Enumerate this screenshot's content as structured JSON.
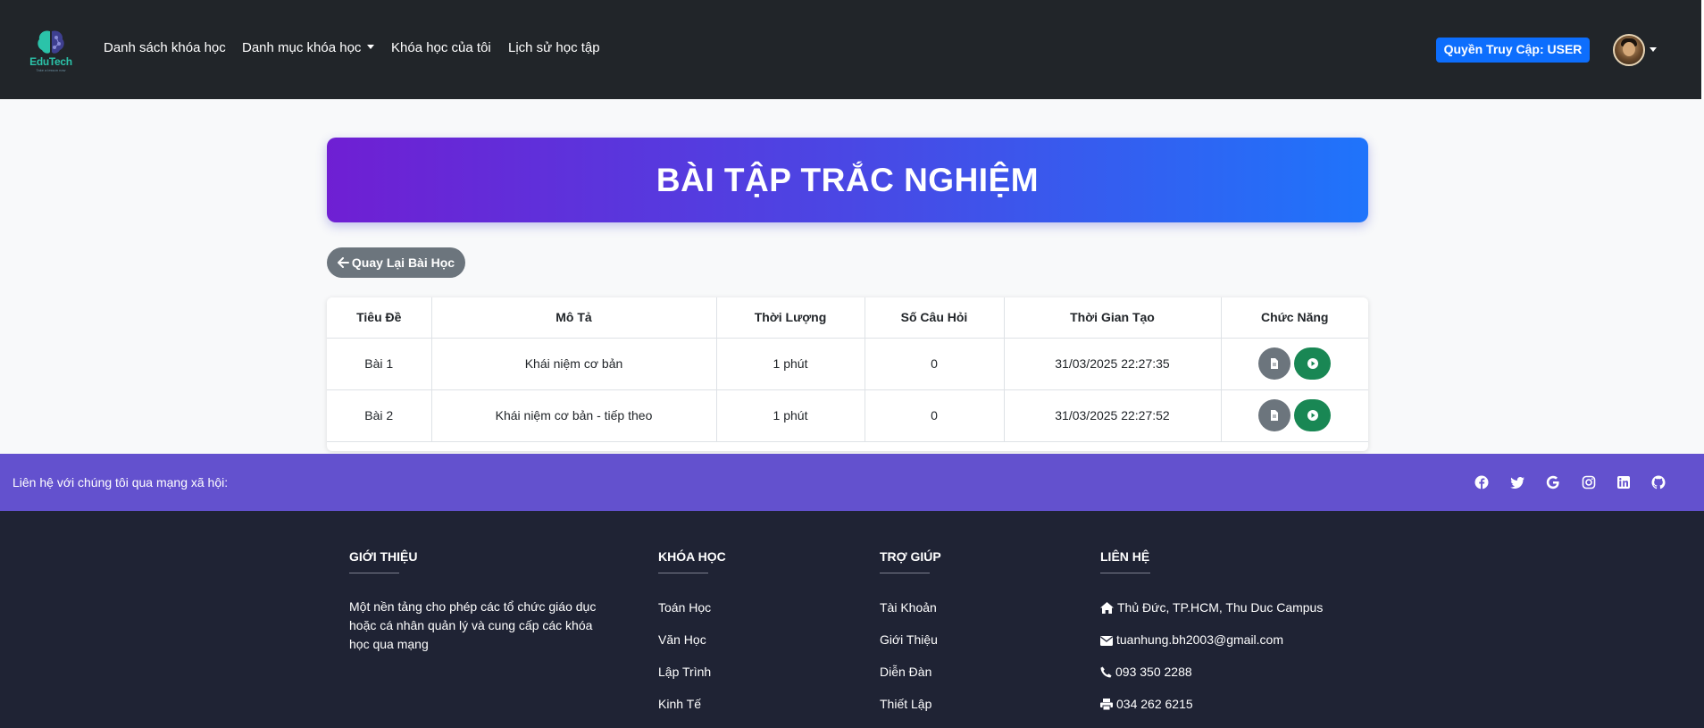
{
  "navbar": {
    "brand": "EduTech",
    "brand_tagline": "Take a lesson now",
    "links": {
      "course_list": "Danh sách khóa học",
      "categories": "Danh mục khóa học",
      "my_courses": "Khóa học của tôi",
      "history": "Lịch sử học tập"
    },
    "role_badge": "Quyền Truy Cập: USER"
  },
  "page": {
    "title": "BÀI TẬP TRẮC NGHIỆM",
    "back_button": "Quay Lại Bài Học"
  },
  "table": {
    "headers": [
      "Tiêu Đề",
      "Mô Tả",
      "Thời Lượng",
      "Số Câu Hỏi",
      "Thời Gian Tạo",
      "Chức Năng"
    ],
    "rows": [
      {
        "title": "Bài 1",
        "description": "Khái niệm cơ bản",
        "duration": "1 phút",
        "questions": "0",
        "created": "31/03/2025 22:27:35"
      },
      {
        "title": "Bài 2",
        "description": "Khái niệm cơ bản - tiếp theo",
        "duration": "1 phút",
        "questions": "0",
        "created": "31/03/2025 22:27:52"
      }
    ],
    "action_icons": [
      "document-icon",
      "play-icon"
    ]
  },
  "social": {
    "text": "Liên hệ với chúng tôi qua mạng xã hội:",
    "icons": [
      "facebook-icon",
      "twitter-icon",
      "google-icon",
      "instagram-icon",
      "linkedin-icon",
      "github-icon"
    ]
  },
  "footer": {
    "about": {
      "heading": "GIỚI THIỆU",
      "text": "Một nền tảng cho phép các tổ chức giáo dục hoặc cá nhân quản lý và cung cấp các khóa học qua mạng"
    },
    "courses": {
      "heading": "KHÓA HỌC",
      "items": [
        "Toán Học",
        "Văn Học",
        "Lập Trình",
        "Kinh Tế"
      ]
    },
    "help": {
      "heading": "TRỢ GIÚP",
      "items": [
        "Tài Khoản",
        "Giới Thiệu",
        "Diễn Đàn",
        "Thiết Lập"
      ]
    },
    "contact": {
      "heading": "LIÊN HỆ",
      "address": "Thủ Đức, TP.HCM, Thu Duc Campus",
      "email": "tuanhung.bh2003@gmail.com",
      "phone": "093 350 2288",
      "fax": "034 262 6215"
    }
  },
  "colors": {
    "navbar": "#212529",
    "banner_start": "#6f1fd3",
    "banner_end": "#1f74fb",
    "role_badge": "#0d6efd",
    "social_bar": "#6351ce",
    "footer": "#1f2334",
    "play_button": "#198754",
    "doc_button": "#6c757d"
  }
}
